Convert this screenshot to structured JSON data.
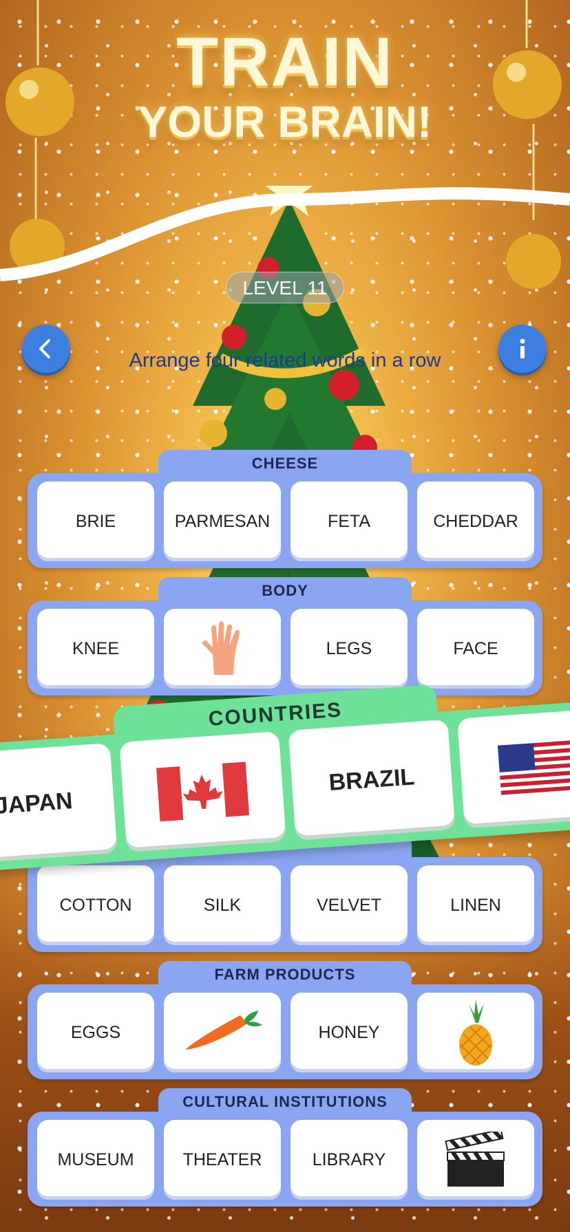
{
  "title": {
    "line1": "TRAIN",
    "line2": "YOUR BRAIN!"
  },
  "level": {
    "label": "LEVEL 11"
  },
  "instructions": "Arrange four related words in a row",
  "groups": [
    {
      "category": "CHEESE",
      "cells": [
        {
          "text": "BRIE"
        },
        {
          "text": "PARMESAN"
        },
        {
          "text": "FETA"
        },
        {
          "text": "CHEDDAR"
        }
      ]
    },
    {
      "category": "BODY",
      "cells": [
        {
          "text": "KNEE"
        },
        {
          "icon": "hand-icon"
        },
        {
          "text": "LEGS"
        },
        {
          "text": "FACE"
        }
      ]
    },
    {
      "category": "",
      "cells": [
        {
          "text": "COTTON"
        },
        {
          "text": "SILK"
        },
        {
          "text": "VELVET"
        },
        {
          "text": "LINEN"
        }
      ]
    },
    {
      "category": "FARM PRODUCTS",
      "cells": [
        {
          "text": "EGGS"
        },
        {
          "icon": "carrot-icon"
        },
        {
          "text": "HONEY"
        },
        {
          "icon": "pineapple-icon"
        }
      ]
    },
    {
      "category": "CULTURAL INSTITUTIONS",
      "cells": [
        {
          "text": "MUSEUM"
        },
        {
          "text": "THEATER"
        },
        {
          "text": "LIBRARY"
        },
        {
          "icon": "clapperboard-icon"
        }
      ]
    }
  ],
  "countries": {
    "category": "COUNTRIES",
    "cells": [
      {
        "text": "JAPAN"
      },
      {
        "icon": "canada-flag-icon"
      },
      {
        "text": "BRAZIL"
      },
      {
        "icon": "usa-flag-icon"
      }
    ]
  },
  "colors": {
    "group_bg": "#8aa6f2",
    "countries_bg": "#6fe29a",
    "button_blue": "#3d7fe0"
  }
}
